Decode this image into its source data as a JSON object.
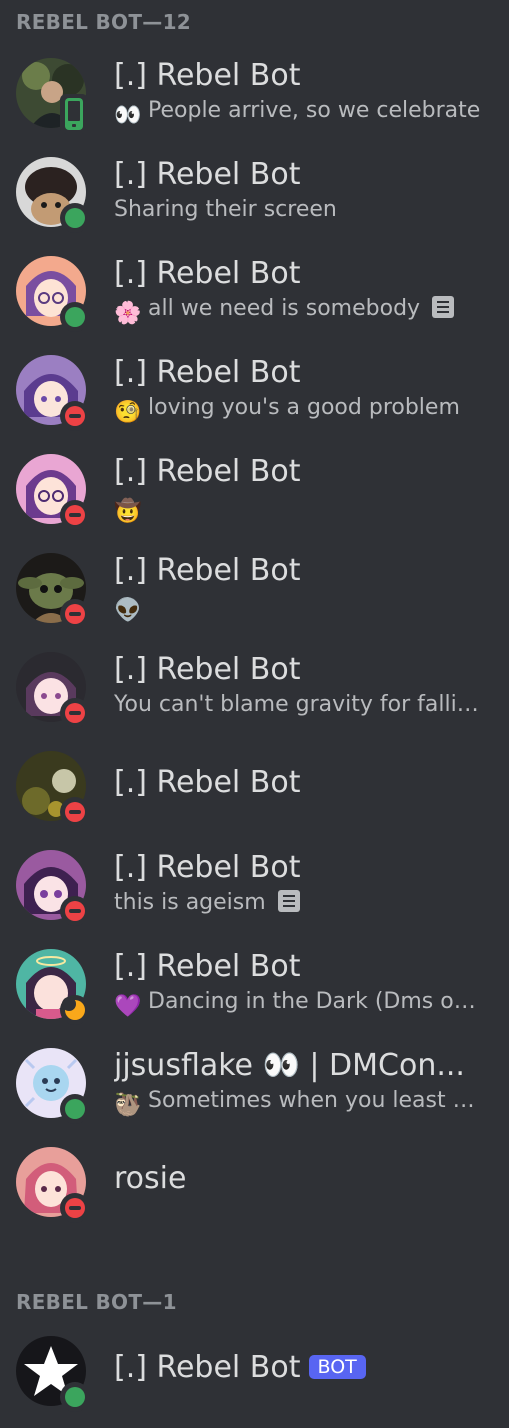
{
  "sections": [
    {
      "header": "REBEL BOT—12"
    },
    {
      "header": "REBEL BOT—1"
    }
  ],
  "members": [
    {
      "name": "[.] Rebel Bot",
      "status": "mobile",
      "emoji": "eyes-emoji",
      "emoji_glyph": "👀",
      "activity": "People arrive, so we celebrate",
      "has_note": false
    },
    {
      "name": "[.] Rebel Bot",
      "status": "online",
      "activity": "Sharing their screen",
      "has_note": false
    },
    {
      "name": "[.] Rebel Bot",
      "status": "online",
      "emoji": "cherry-blossom-emoji",
      "emoji_glyph": "🌸",
      "activity": "all we need is somebody",
      "has_note": true
    },
    {
      "name": "[.] Rebel Bot",
      "status": "dnd",
      "emoji": "monocle-face-emoji",
      "emoji_glyph": "🧐",
      "activity": "loving you's a good problem",
      "has_note": false
    },
    {
      "name": "[.] Rebel Bot",
      "status": "dnd",
      "emoji": "cowboy-emoji",
      "emoji_glyph": "🤠",
      "activity": "",
      "has_note": false
    },
    {
      "name": "[.] Rebel Bot",
      "status": "dnd",
      "emoji": "yoda-emoji",
      "emoji_glyph": "👽",
      "activity": "",
      "has_note": false
    },
    {
      "name": "[.] Rebel Bot",
      "status": "dnd",
      "activity": "You can't blame gravity for falling in love",
      "has_note": false
    },
    {
      "name": "[.] Rebel Bot",
      "status": "dnd",
      "activity": "",
      "has_note": false
    },
    {
      "name": "[.] Rebel Bot",
      "status": "dnd",
      "activity": "this is ageism",
      "has_note": true
    },
    {
      "name": "[.] Rebel Bot",
      "status": "idle",
      "emoji": "purple-heart-emoji",
      "emoji_glyph": "💜",
      "activity": "Dancing in the Dark (Dms open)",
      "has_note": false
    },
    {
      "name": "jjsusflake 👀 | DMCon...",
      "status": "online",
      "emoji": "sloth-emoji",
      "emoji_glyph": "🦥",
      "activity": "Sometimes when you least expect it",
      "has_note": false
    },
    {
      "name": "rosie",
      "status": "dnd",
      "activity": "",
      "has_note": false
    },
    {
      "name": "[.] Rebel Bot",
      "status": "online",
      "activity": "",
      "has_note": false,
      "bot_tag": "BOT"
    }
  ],
  "colors": {
    "background": "#2f3136",
    "online": "#3ba55d",
    "dnd": "#ed4245",
    "idle": "#faa81a",
    "bot_tag": "#5865f2"
  }
}
